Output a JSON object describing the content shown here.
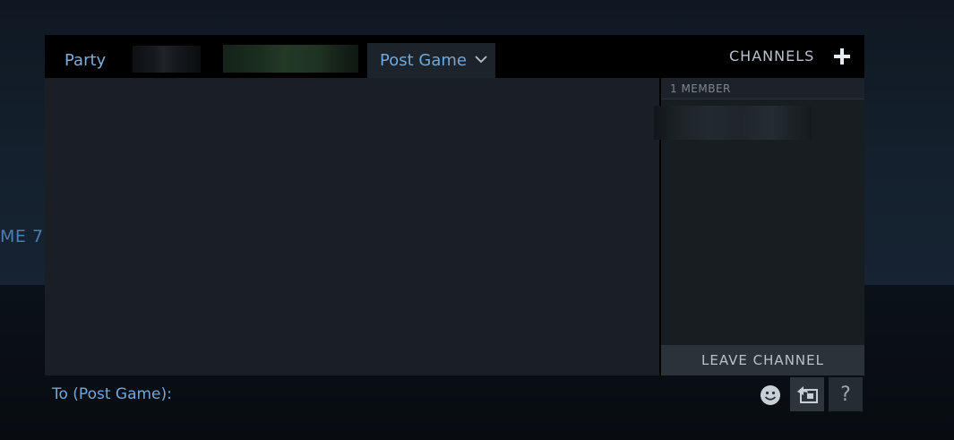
{
  "background": {
    "partial_text": "ME 7"
  },
  "tabs": {
    "party_label": "Party",
    "active_label": "Post Game",
    "active_icon": "chevron-down-icon"
  },
  "channels": {
    "label": "CHANNELS",
    "add_icon": "plus-icon"
  },
  "members": {
    "count_label": "1 MEMBER",
    "leave_label": "LEAVE CHANNEL"
  },
  "input": {
    "to_label": "To (Post Game):",
    "value": "",
    "emoji_icon": "smiley-icon",
    "share_icon": "share-screenshot-icon",
    "help_label": "?"
  },
  "colors": {
    "accent_blue": "#6fa8dc",
    "panel_dark": "#1a1f25"
  }
}
